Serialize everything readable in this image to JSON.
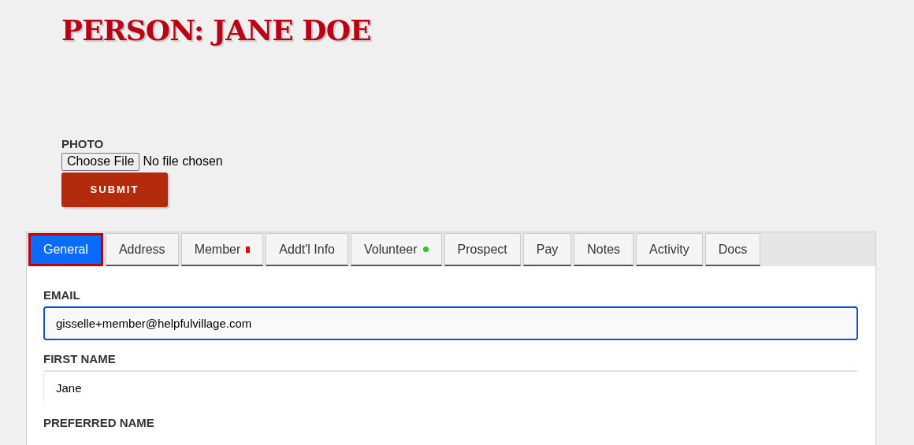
{
  "title": "PERSON: JANE DOE",
  "photo": {
    "label": "PHOTO",
    "button": "Choose File",
    "status": "No file chosen"
  },
  "submit": "SUBMIT",
  "tabs": [
    {
      "label": "General",
      "selected": true
    },
    {
      "label": "Address",
      "selected": false
    },
    {
      "label": "Member",
      "selected": false,
      "indicator": {
        "kind": "square",
        "color": "#ee0000"
      }
    },
    {
      "label": "Addt'l Info",
      "selected": false
    },
    {
      "label": "Volunteer",
      "selected": false,
      "indicator": {
        "kind": "dot",
        "color": "#22cc22"
      }
    },
    {
      "label": "Prospect",
      "selected": false
    },
    {
      "label": "Pay",
      "selected": false
    },
    {
      "label": "Notes",
      "selected": false
    },
    {
      "label": "Activity",
      "selected": false
    },
    {
      "label": "Docs",
      "selected": false
    }
  ],
  "fields": [
    {
      "label": "EMAIL",
      "value": "gisselle+member@helpfulvillage.com",
      "focused": true
    },
    {
      "label": "FIRST NAME",
      "value": "Jane",
      "focused": false
    },
    {
      "label": "PREFERRED NAME"
    }
  ]
}
